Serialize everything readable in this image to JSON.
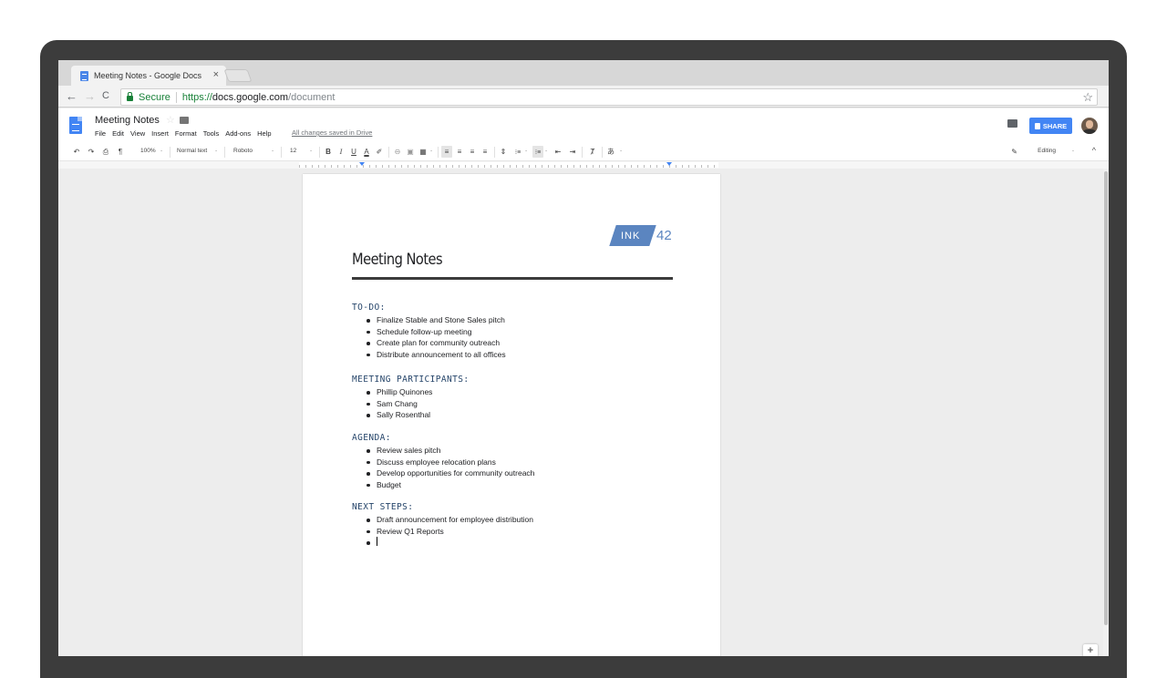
{
  "browser": {
    "tab_title": "Meeting Notes - Google Docs",
    "tab_close": "×",
    "nav_back": "←",
    "nav_forward": "→",
    "nav_reload": "C",
    "secure_label": "Secure",
    "url_scheme": "https://",
    "url_domain": "docs.google.com",
    "url_path": "/document",
    "bookmark_star": "☆"
  },
  "docs_header": {
    "doc_title": "Meeting Notes",
    "title_star": "☆",
    "menu": [
      "File",
      "Edit",
      "View",
      "Insert",
      "Format",
      "Tools",
      "Add-ons",
      "Help"
    ],
    "saved_status": "All changes saved in Drive",
    "share_label": "SHARE"
  },
  "toolbar": {
    "undo": "↶",
    "redo": "↷",
    "print": "⎙",
    "paint_format": "¶",
    "zoom": "100%",
    "zoom_caret": "-",
    "style": "Normal text",
    "style_caret": "-",
    "font": "Roboto",
    "font_caret": "-",
    "font_size": "12",
    "font_size_caret": "-",
    "bold": "B",
    "italic": "I",
    "underline": "U",
    "text_color": "A",
    "highlight": "✐",
    "link": "⊖",
    "comment": "▣",
    "image": "▦",
    "image_caret": "-",
    "align_left": "≡",
    "align_center": "≡",
    "align_right": "≡",
    "align_justify": "≡",
    "line_spacing": "⇕",
    "numbered_list": "⁝≡",
    "numbered_caret": "-",
    "bulleted_list": "⁝≡",
    "bulleted_caret": "-",
    "decrease_indent": "⇤",
    "increase_indent": "⇥",
    "clear_format": "Ⱦ",
    "input_tools": "あ",
    "input_caret": "-",
    "editing_label": "Editing",
    "editing_caret": "-",
    "collapse": "^"
  },
  "document": {
    "ink_label": "INK",
    "ink_number": "42",
    "title": "Meeting Notes",
    "sections": [
      {
        "heading": "TO-DO:",
        "items": [
          "Finalize Stable and Stone Sales pitch",
          "Schedule follow-up meeting",
          "Create plan for community outreach",
          "Distribute announcement to all offices"
        ]
      },
      {
        "heading": "MEETING PARTICIPANTS:",
        "items": [
          "Phillip Quinones",
          "Sam Chang",
          "Sally Rosenthal"
        ]
      },
      {
        "heading": "AGENDA:",
        "items": [
          "Review sales pitch",
          "Discuss employee relocation plans",
          "Develop opportunities for community outreach",
          "Budget"
        ]
      },
      {
        "heading": "NEXT STEPS:",
        "items": [
          "Draft announcement for employee distribution",
          "Review Q1 Reports",
          ""
        ]
      }
    ]
  },
  "fab_label": "+",
  "colors": {
    "accent_blue": "#4285f4",
    "ink_blue": "#5b85c0",
    "heading_navy": "#27466b",
    "secure_green": "#188038"
  }
}
